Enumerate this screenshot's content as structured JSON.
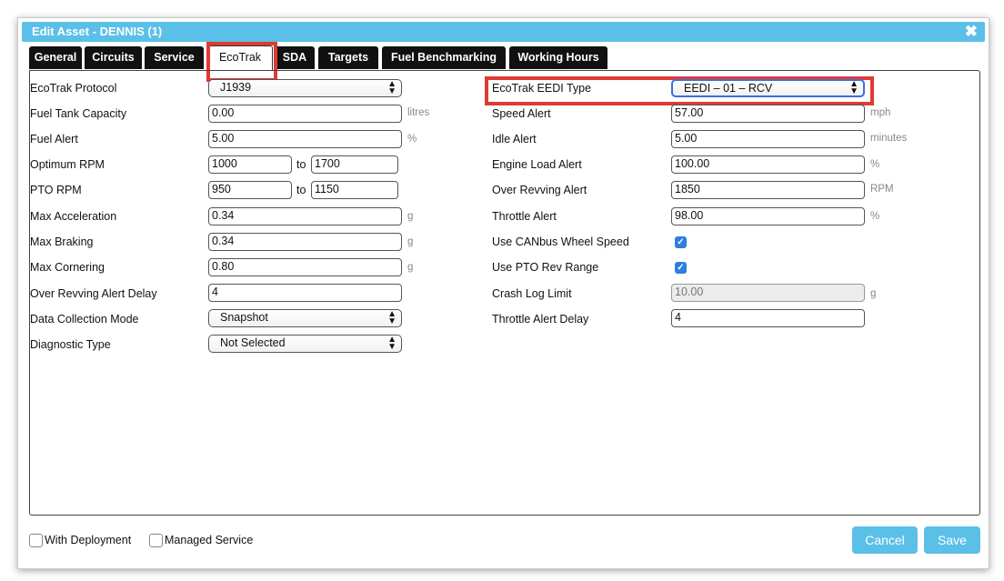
{
  "window": {
    "title": "Edit Asset - DENNIS (1)",
    "close_glyph": "✖"
  },
  "tabs": [
    "General",
    "Circuits",
    "Service",
    "EcoTrak",
    "SDA",
    "Targets",
    "Fuel Benchmarking",
    "Working Hours"
  ],
  "active_tab": "EcoTrak",
  "left": {
    "protocol_label": "EcoTrak Protocol",
    "protocol_value": "J1939",
    "fuel_tank_label": "Fuel Tank Capacity",
    "fuel_tank_value": "0.00",
    "fuel_tank_unit": "litres",
    "fuel_alert_label": "Fuel Alert",
    "fuel_alert_value": "5.00",
    "fuel_alert_unit": "%",
    "optimum_rpm_label": "Optimum RPM",
    "optimum_rpm_from": "1000",
    "optimum_rpm_to": "1700",
    "pto_rpm_label": "PTO RPM",
    "pto_rpm_from": "950",
    "pto_rpm_to": "1150",
    "to_text": "to",
    "max_accel_label": "Max Acceleration",
    "max_accel_value": "0.34",
    "max_braking_label": "Max Braking",
    "max_braking_value": "0.34",
    "max_cornering_label": "Max Cornering",
    "max_cornering_value": "0.80",
    "g_unit": "g",
    "over_rev_delay_label": "Over Revving Alert Delay",
    "over_rev_delay_value": "4",
    "data_mode_label": "Data Collection Mode",
    "data_mode_value": "Snapshot",
    "diag_type_label": "Diagnostic Type",
    "diag_type_value": "Not Selected"
  },
  "right": {
    "eedi_label": "EcoTrak EEDI Type",
    "eedi_value": "EEDI – 01 – RCV",
    "speed_alert_label": "Speed Alert",
    "speed_alert_value": "57.00",
    "speed_alert_unit": "mph",
    "idle_alert_label": "Idle Alert",
    "idle_alert_value": "5.00",
    "idle_alert_unit": "minutes",
    "engine_load_label": "Engine Load Alert",
    "engine_load_value": "100.00",
    "engine_load_unit": "%",
    "over_rev_label": "Over Revving Alert",
    "over_rev_value": "1850",
    "over_rev_unit": "RPM",
    "throttle_alert_label": "Throttle Alert",
    "throttle_alert_value": "98.00",
    "throttle_alert_unit": "%",
    "canbus_label": "Use CANbus Wheel Speed",
    "canbus_checked": true,
    "pto_range_label": "Use PTO Rev Range",
    "pto_range_checked": true,
    "crash_log_label": "Crash Log Limit",
    "crash_log_value": "10.00",
    "crash_log_unit": "g",
    "throttle_delay_label": "Throttle Alert Delay",
    "throttle_delay_value": "4"
  },
  "footer": {
    "with_deployment_label": "With Deployment",
    "with_deployment_checked": false,
    "managed_service_label": "Managed Service",
    "managed_service_checked": false,
    "cancel_label": "Cancel",
    "save_label": "Save"
  },
  "colors": {
    "accent": "#5bc0e8",
    "highlight": "#e03a34",
    "tab_bg": "#111111",
    "checkbox": "#2f7de1"
  }
}
